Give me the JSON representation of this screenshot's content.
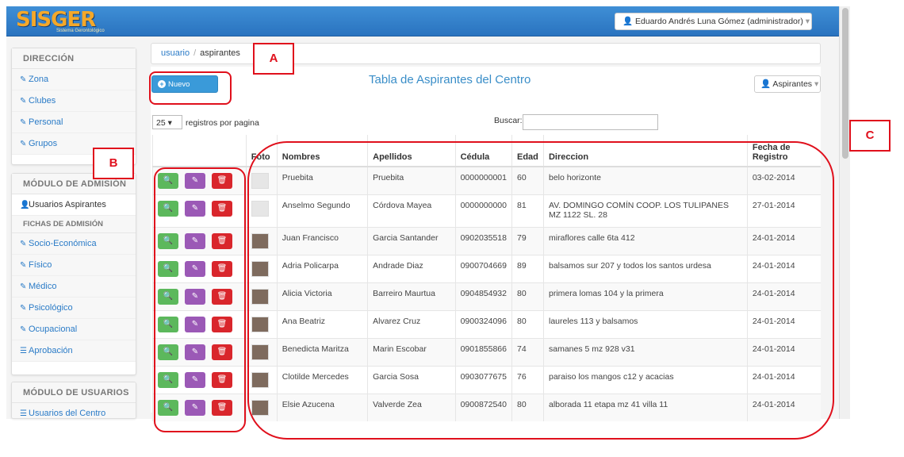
{
  "header": {
    "logo": "SISGER",
    "logo_subtitle": "Sistema Gerontológico",
    "user_label": "Eduardo Andrés Luna Gómez (administrador)"
  },
  "sidebar": {
    "direccion": {
      "heading": "DIRECCIÓN",
      "items": [
        {
          "label": "Zona"
        },
        {
          "label": "Clubes"
        },
        {
          "label": "Personal"
        },
        {
          "label": "Grupos"
        }
      ]
    },
    "admision": {
      "heading": "MÓDULO DE ADMISIÓN",
      "items": [
        {
          "label": "Usuarios Aspirantes"
        }
      ],
      "subheading": "FICHAS DE ADMISIÓN",
      "fichas": [
        {
          "label": "Socio-Económica"
        },
        {
          "label": "Físico"
        },
        {
          "label": "Médico"
        },
        {
          "label": "Psicológico"
        },
        {
          "label": "Ocupacional"
        },
        {
          "label": "Aprobación"
        }
      ]
    },
    "usuarios": {
      "heading": "MÓDULO DE USUARIOS",
      "items": [
        {
          "label": "Usuarios del Centro"
        }
      ]
    }
  },
  "breadcrumb": {
    "root": "usuario",
    "sep": "/",
    "current": "aspirantes"
  },
  "toolbar": {
    "new_user": "Nuevo Usuario",
    "title": "Tabla de Aspirantes del Centro",
    "filter": "Aspirantes"
  },
  "table_controls": {
    "per_page_value": "25",
    "per_page_label": "registros por pagina",
    "search_label": "Buscar:"
  },
  "table": {
    "headers": {
      "foto": "Foto",
      "nombres": "Nombres",
      "apellidos": "Apellidos",
      "cedula": "Cédula",
      "edad": "Edad",
      "direccion": "Direccion",
      "fecha1": "Fecha de",
      "fecha2": "Registro"
    },
    "rows": [
      {
        "nombres": "Pruebita",
        "apellidos": "Pruebita",
        "cedula": "0000000001",
        "edad": "60",
        "direccion": "belo horizonte",
        "fecha": "03-02-2014"
      },
      {
        "nombres": "Anselmo Segundo",
        "apellidos": "Córdova Mayea",
        "cedula": "0000000000",
        "edad": "81",
        "direccion": "AV. DOMINGO COMÍN COOP. LOS TULIPANES MZ 1122 SL. 28",
        "fecha": "27-01-2014"
      },
      {
        "nombres": "Juan Francisco",
        "apellidos": "Garcia Santander",
        "cedula": "0902035518",
        "edad": "79",
        "direccion": "miraflores calle 6ta 412",
        "fecha": "24-01-2014"
      },
      {
        "nombres": "Adria Policarpa",
        "apellidos": "Andrade Diaz",
        "cedula": "0900704669",
        "edad": "89",
        "direccion": "balsamos sur 207 y todos los santos urdesa",
        "fecha": "24-01-2014"
      },
      {
        "nombres": "Alicia Victoria",
        "apellidos": "Barreiro Maurtua",
        "cedula": "0904854932",
        "edad": "80",
        "direccion": "primera lomas 104 y la primera",
        "fecha": "24-01-2014"
      },
      {
        "nombres": "Ana Beatriz",
        "apellidos": "Alvarez Cruz",
        "cedula": "0900324096",
        "edad": "80",
        "direccion": "laureles 113 y balsamos",
        "fecha": "24-01-2014"
      },
      {
        "nombres": "Benedicta Maritza",
        "apellidos": "Marin Escobar",
        "cedula": "0901855866",
        "edad": "74",
        "direccion": "samanes 5 mz 928 v31",
        "fecha": "24-01-2014"
      },
      {
        "nombres": "Clotilde Mercedes",
        "apellidos": "Garcia Sosa",
        "cedula": "0903077675",
        "edad": "76",
        "direccion": "paraiso los mangos c12 y acacias",
        "fecha": "24-01-2014"
      },
      {
        "nombres": "Elsie Azucena",
        "apellidos": "Valverde Zea",
        "cedula": "0900872540",
        "edad": "80",
        "direccion": "alborada 11 etapa mz 41 villa 11",
        "fecha": "24-01-2014"
      }
    ]
  },
  "annotations": {
    "a": "A",
    "b": "B",
    "c": "C",
    "color": "#e0101c"
  },
  "colors": {
    "topbar": "#2f7fca",
    "primary": "#3a9ad9",
    "view": "#5cb85c",
    "edit": "#9b59b6",
    "delete": "#d9262c",
    "link": "#2a7bc7"
  }
}
